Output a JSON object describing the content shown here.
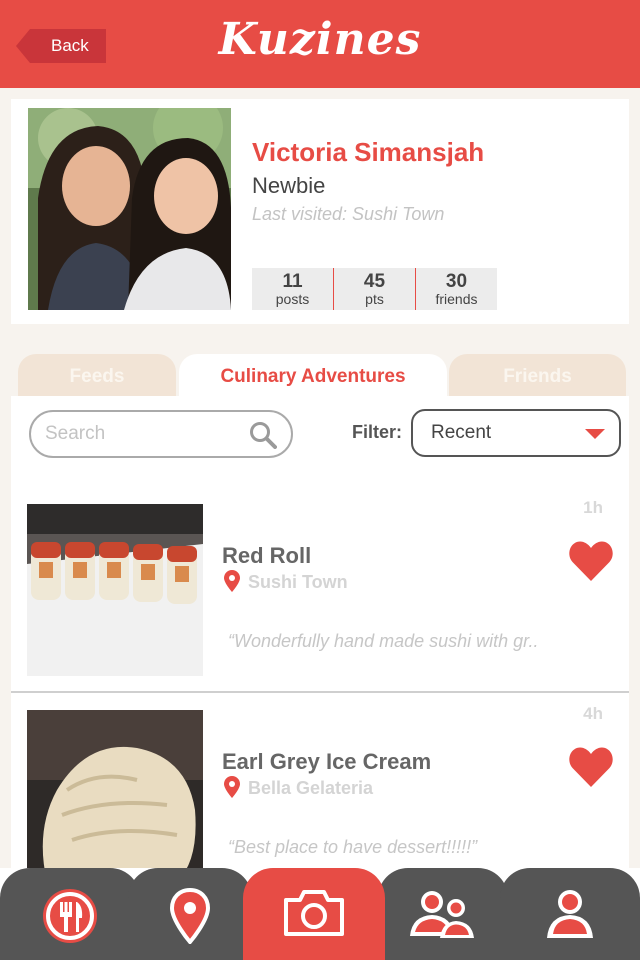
{
  "header": {
    "back_label": "Back",
    "logo": "Kuzines"
  },
  "profile": {
    "name": "Victoria Simansjah",
    "rank": "Newbie",
    "last_visited": "Last visited: Sushi Town",
    "stats": [
      {
        "value": "11",
        "label": "posts"
      },
      {
        "value": "45",
        "label": "pts"
      },
      {
        "value": "30",
        "label": "friends"
      }
    ]
  },
  "tabs": [
    {
      "label": "Feeds"
    },
    {
      "label": "Culinary Adventures"
    },
    {
      "label": "Friends"
    }
  ],
  "search": {
    "placeholder": "Search"
  },
  "filter": {
    "label": "Filter:",
    "value": "Recent"
  },
  "items": [
    {
      "time": "1h",
      "title": "Red Roll",
      "place": "Sushi Town",
      "quote": "“Wonderfully hand made sushi with gr.."
    },
    {
      "time": "4h",
      "title": "Earl Grey Ice Cream",
      "place": "Bella Gelateria",
      "quote": "“Best place to have dessert!!!!!”"
    }
  ],
  "nav": {
    "items": [
      "fork-knife-icon",
      "location-pin-icon",
      "camera-icon",
      "friends-icon",
      "profile-icon"
    ]
  },
  "colors": {
    "accent": "#e74c45",
    "dark": "#555555",
    "tab_inactive": "#f2e4d6"
  }
}
